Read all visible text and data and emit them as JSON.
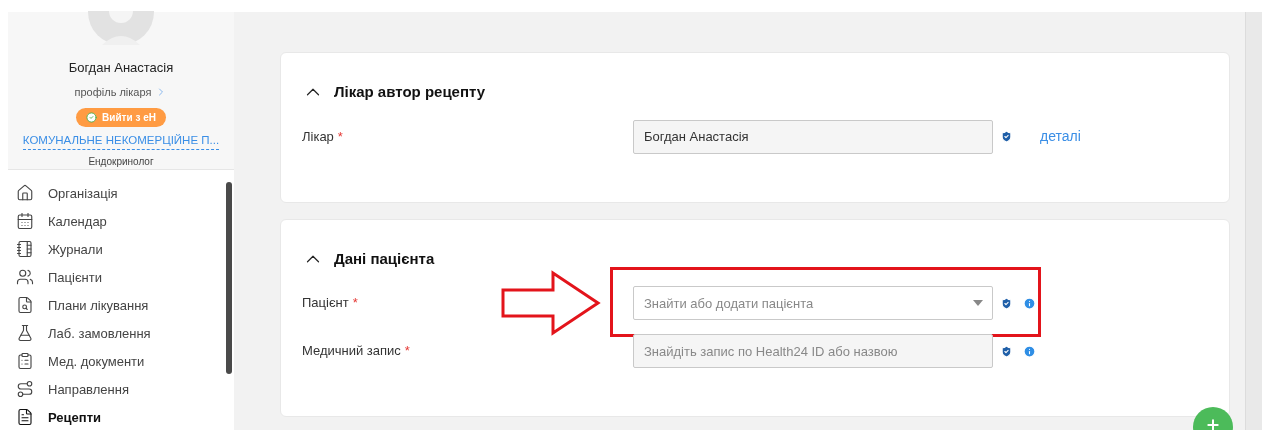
{
  "sidebar": {
    "profile": {
      "name": "Богдан Анастасія",
      "profile_link": "профіль лікаря",
      "logout_button": "Вийти з еН",
      "organization": "КОМУНАЛЬНЕ НЕКОМЕРЦІЙНЕ П...",
      "specialty": "Ендокринолог"
    },
    "nav_items": [
      {
        "label": "Організація",
        "selected": false
      },
      {
        "label": "Календар",
        "selected": false
      },
      {
        "label": "Журнали",
        "selected": false
      },
      {
        "label": "Пацієнти",
        "selected": false
      },
      {
        "label": "Плани лікування",
        "selected": false
      },
      {
        "label": "Лаб. замовлення",
        "selected": false
      },
      {
        "label": "Мед. документи",
        "selected": false
      },
      {
        "label": "Направлення",
        "selected": false
      },
      {
        "label": "Рецепти",
        "selected": true
      }
    ]
  },
  "sections": [
    {
      "title": "Лікар автор рецепту",
      "expanded": true,
      "fields": [
        {
          "label": "Лікар",
          "required_mark": "*",
          "value": "Богдан Анастасія",
          "dropdown": false,
          "info": false,
          "highlighted": false,
          "link": "деталі"
        }
      ]
    },
    {
      "title": "Дані пацієнта",
      "expanded": true,
      "fields": [
        {
          "label": "Пацієнт",
          "required_mark": "*",
          "placeholder": "Знайти або додати пацієнта",
          "dropdown": true,
          "info": true,
          "highlighted": true
        },
        {
          "label": "Медичний запис",
          "required_mark": "*",
          "placeholder": "Знайдіть запис по Health24 ID або назвою",
          "dropdown": false,
          "info": true,
          "highlighted": false
        }
      ]
    }
  ]
}
